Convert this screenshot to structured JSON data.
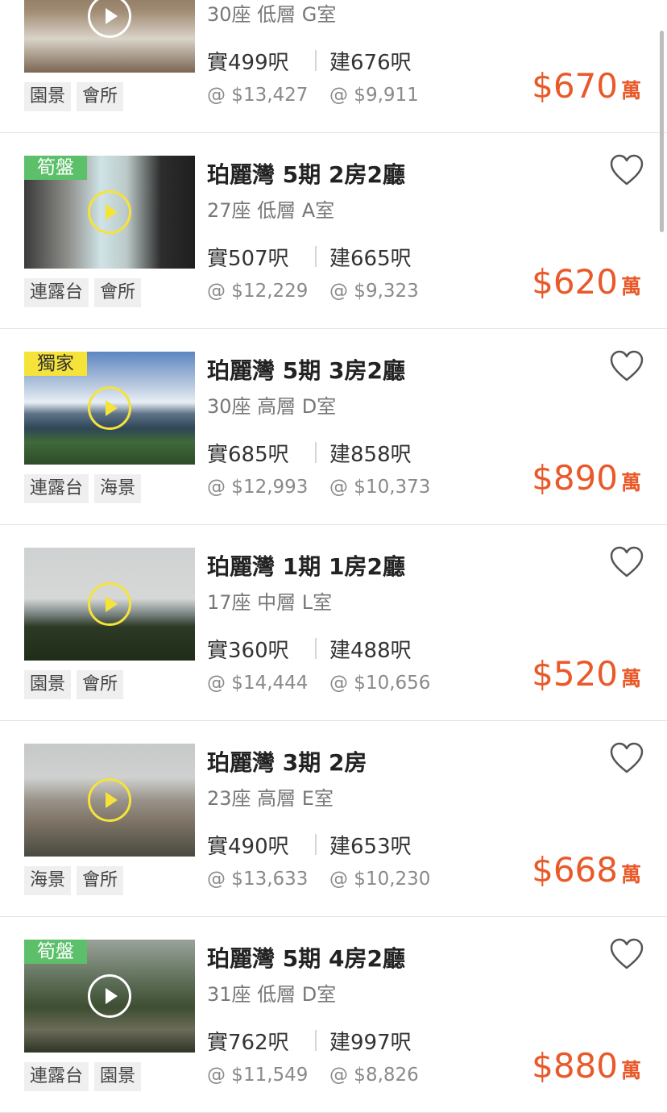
{
  "listings": [
    {
      "ribbon": null,
      "title": "",
      "subtitle": "30座 低層 G室",
      "area_real": "實499呎",
      "area_build": "建676呎",
      "pp_real": "@ $13,427",
      "pp_build": "@ $9,911",
      "tags": [
        "園景",
        "會所"
      ],
      "price": "$670",
      "price_unit": "萬",
      "play_color": "white",
      "photo": "living-room"
    },
    {
      "ribbon": "筍盤",
      "ribbon_color": "green",
      "title": "珀麗灣 5期 2房2廳",
      "subtitle": "27座 低層 A室",
      "area_real": "實507呎",
      "area_build": "建665呎",
      "pp_real": "@ $12,229",
      "pp_build": "@ $9,323",
      "tags": [
        "連露台",
        "會所"
      ],
      "price": "$620",
      "price_unit": "萬",
      "play_color": "yellow",
      "photo": "corridor"
    },
    {
      "ribbon": "獨家",
      "ribbon_color": "yellow",
      "title": "珀麗灣 5期 3房2廳",
      "subtitle": "30座 高層 D室",
      "area_real": "實685呎",
      "area_build": "建858呎",
      "pp_real": "@ $12,993",
      "pp_build": "@ $10,373",
      "tags": [
        "連露台",
        "海景"
      ],
      "price": "$890",
      "price_unit": "萬",
      "play_color": "yellow",
      "photo": "sea-view"
    },
    {
      "ribbon": null,
      "title": "珀麗灣 1期 1房2廳",
      "subtitle": "17座 中層 L室",
      "area_real": "實360呎",
      "area_build": "建488呎",
      "pp_real": "@ $14,444",
      "pp_build": "@ $10,656",
      "tags": [
        "園景",
        "會所"
      ],
      "price": "$520",
      "price_unit": "萬",
      "play_color": "yellow",
      "photo": "bridge-trees"
    },
    {
      "ribbon": null,
      "title": "珀麗灣 3期 2房",
      "subtitle": "23座 高層 E室",
      "area_real": "實490呎",
      "area_build": "建653呎",
      "pp_real": "@ $13,633",
      "pp_build": "@ $10,230",
      "tags": [
        "海景",
        "會所"
      ],
      "price": "$668",
      "price_unit": "萬",
      "play_color": "yellow",
      "photo": "buildings"
    },
    {
      "ribbon": "筍盤",
      "ribbon_color": "green",
      "title": "珀麗灣 5期 4房2廳",
      "subtitle": "31座 低層 D室",
      "area_real": "實762呎",
      "area_build": "建997呎",
      "pp_real": "@ $11,549",
      "pp_build": "@ $8,826",
      "tags": [
        "連露台",
        "園景"
      ],
      "price": "$880",
      "price_unit": "萬",
      "play_color": "white",
      "photo": "garden"
    }
  ]
}
